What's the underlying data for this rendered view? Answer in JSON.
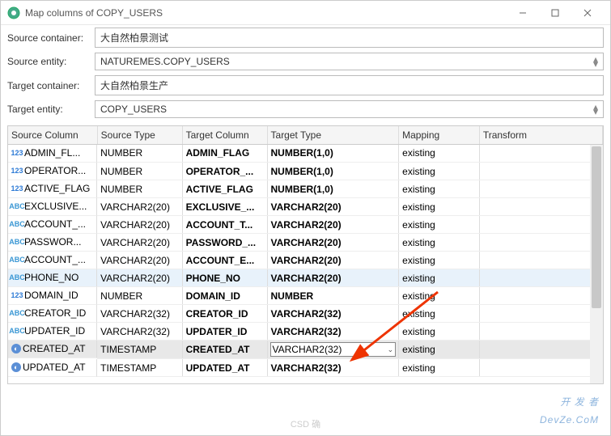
{
  "window": {
    "title": "Map columns of COPY_USERS"
  },
  "form": {
    "source_container": {
      "label": "Source container:",
      "value": "大自然柏景测试"
    },
    "source_entity": {
      "label": "Source entity:",
      "value": "NATUREMES.COPY_USERS"
    },
    "target_container": {
      "label": "Target container:",
      "value": "大自然柏景生产"
    },
    "target_entity": {
      "label": "Target entity:",
      "value": "COPY_USERS"
    }
  },
  "columns": {
    "headers": [
      "Source Column",
      "Source Type",
      "Target Column",
      "Target Type",
      "Mapping",
      "Transform"
    ],
    "rows": [
      {
        "icon": "num",
        "src": "ADMIN_FL...",
        "stype": "NUMBER",
        "tgt": "ADMIN_FLAG",
        "ttype": "NUMBER(1,0)",
        "map": "existing"
      },
      {
        "icon": "num",
        "src": "OPERATOR...",
        "stype": "NUMBER",
        "tgt": "OPERATOR_...",
        "ttype": "NUMBER(1,0)",
        "map": "existing"
      },
      {
        "icon": "num",
        "src": "ACTIVE_FLAG",
        "stype": "NUMBER",
        "tgt": "ACTIVE_FLAG",
        "ttype": "NUMBER(1,0)",
        "map": "existing"
      },
      {
        "icon": "str",
        "src": "EXCLUSIVE...",
        "stype": "VARCHAR2(20)",
        "tgt": "EXCLUSIVE_...",
        "ttype": "VARCHAR2(20)",
        "map": "existing"
      },
      {
        "icon": "str",
        "src": "ACCOUNT_...",
        "stype": "VARCHAR2(20)",
        "tgt": "ACCOUNT_T...",
        "ttype": "VARCHAR2(20)",
        "map": "existing"
      },
      {
        "icon": "str",
        "src": "PASSWOR...",
        "stype": "VARCHAR2(20)",
        "tgt": "PASSWORD_...",
        "ttype": "VARCHAR2(20)",
        "map": "existing"
      },
      {
        "icon": "str",
        "src": "ACCOUNT_...",
        "stype": "VARCHAR2(20)",
        "tgt": "ACCOUNT_E...",
        "ttype": "VARCHAR2(20)",
        "map": "existing"
      },
      {
        "icon": "str",
        "src": "PHONE_NO",
        "stype": "VARCHAR2(20)",
        "tgt": "PHONE_NO",
        "ttype": "VARCHAR2(20)",
        "map": "existing",
        "hover": true
      },
      {
        "icon": "num",
        "src": "DOMAIN_ID",
        "stype": "NUMBER",
        "tgt": "DOMAIN_ID",
        "ttype": "NUMBER",
        "map": "existing"
      },
      {
        "icon": "str",
        "src": "CREATOR_ID",
        "stype": "VARCHAR2(32)",
        "tgt": "CREATOR_ID",
        "ttype": "VARCHAR2(32)",
        "map": "existing"
      },
      {
        "icon": "str",
        "src": "UPDATER_ID",
        "stype": "VARCHAR2(32)",
        "tgt": "UPDATER_ID",
        "ttype": "VARCHAR2(32)",
        "map": "existing"
      },
      {
        "icon": "ts",
        "src": "CREATED_AT",
        "stype": "TIMESTAMP",
        "tgt": "CREATED_AT",
        "ttype": "VARCHAR2(32)",
        "map": "existing",
        "selected": true,
        "combo": true
      },
      {
        "icon": "ts",
        "src": "UPDATED_AT",
        "stype": "TIMESTAMP",
        "tgt": "UPDATED_AT",
        "ttype": "VARCHAR2(32)",
        "map": "existing"
      }
    ]
  },
  "watermark": {
    "line1": "开 发 者",
    "line2": "DevZe.CoM"
  },
  "footer_ghost": "CSD    确"
}
